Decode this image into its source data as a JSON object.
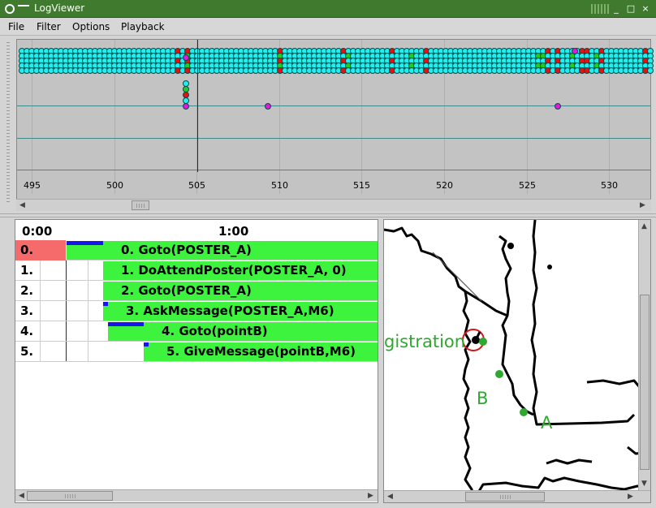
{
  "window": {
    "title": "LogViewer",
    "minimize": "_",
    "maximize": "□",
    "close": "×"
  },
  "menu": {
    "file": "File",
    "filter": "Filter",
    "options": "Options",
    "playback": "Playback"
  },
  "timeline": {
    "ticks": [
      "495",
      "500",
      "505",
      "510",
      "515",
      "520",
      "525",
      "530"
    ]
  },
  "tasks": {
    "time_start": "0:00",
    "time_mid": "1:00",
    "rows": [
      {
        "num": "0.",
        "label": "0. Goto(POSTER_A)"
      },
      {
        "num": "1.",
        "label": "1. DoAttendPoster(POSTER_A, 0)"
      },
      {
        "num": "2.",
        "label": "2. Goto(POSTER_A)"
      },
      {
        "num": "3.",
        "label": "3. AskMessage(POSTER_A,M6)"
      },
      {
        "num": "4.",
        "label": "4. Goto(pointB)"
      },
      {
        "num": "5.",
        "label": "5. GiveMessage(pointB,M6)"
      }
    ]
  },
  "map": {
    "label_registration": "gistration",
    "label_b": "B",
    "label_a": "A"
  },
  "colors": {
    "titlebar": "#3f7a2e",
    "task_bar": "#3ef33e",
    "active_row": "#f56b6b",
    "map_label": "#2ea82e",
    "dot_cyan": "#22eeee",
    "dot_red": "#e01414",
    "dot_green": "#22cc22",
    "dot_magenta": "#e018e0"
  }
}
